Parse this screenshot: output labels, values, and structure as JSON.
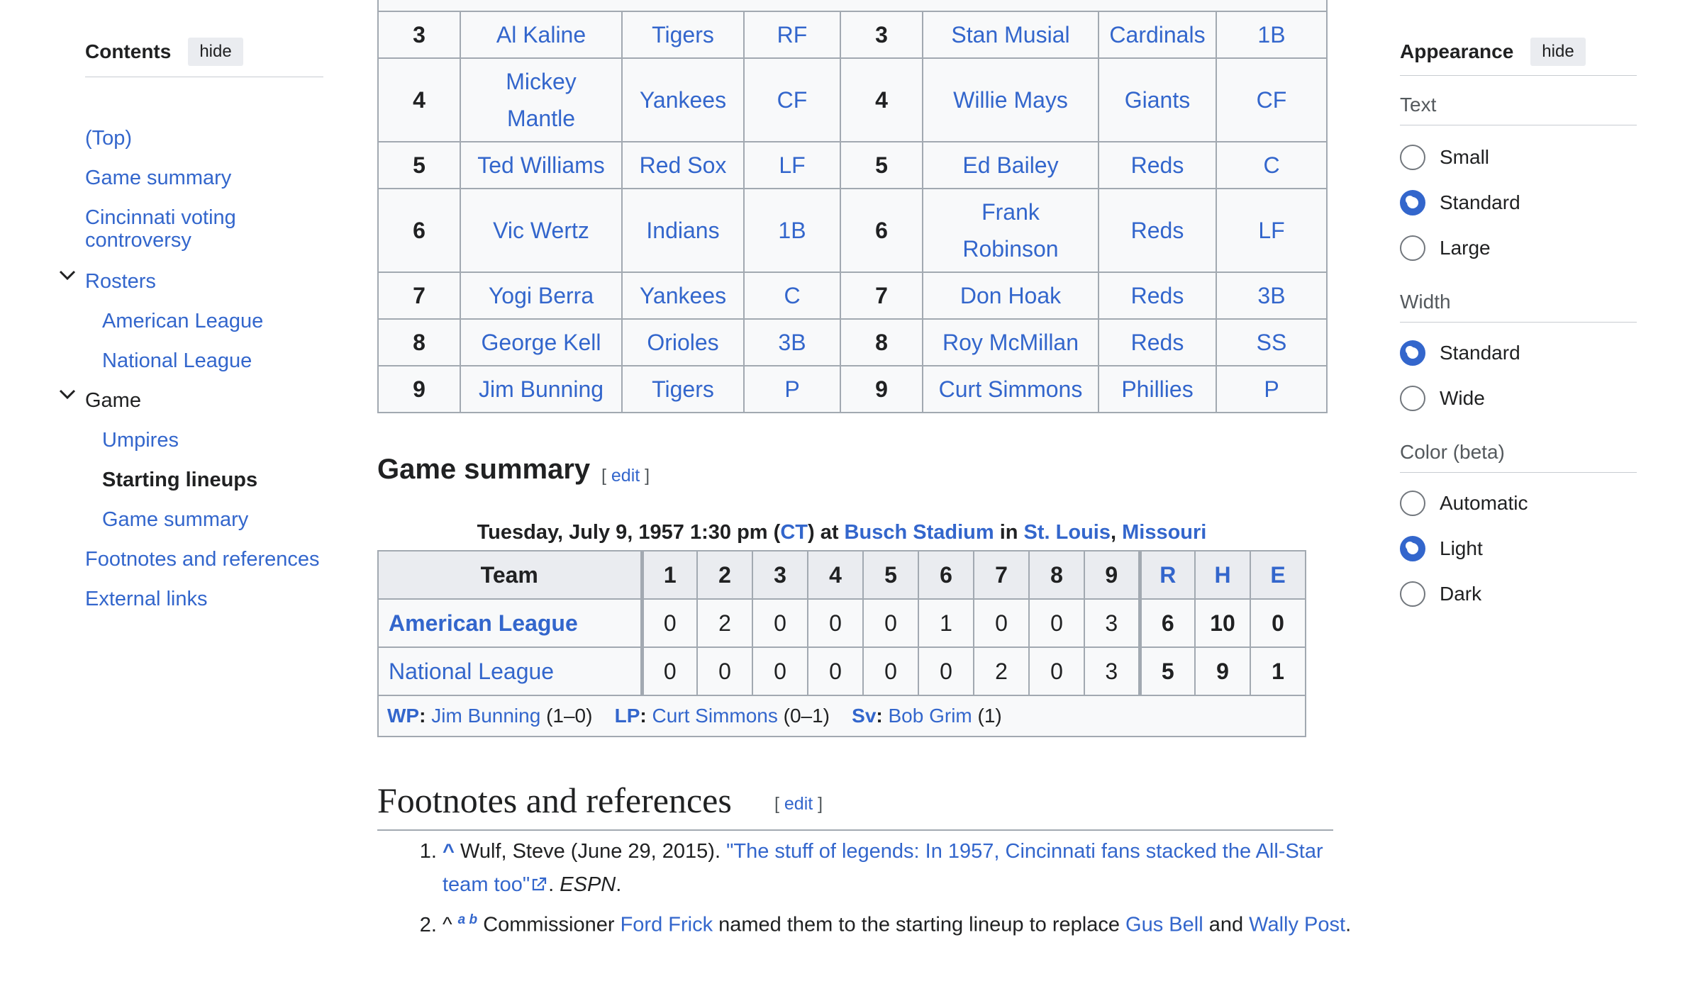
{
  "toc": {
    "title": "Contents",
    "hide_label": "hide",
    "items": {
      "top": "(Top)",
      "game_summary": "Game summary",
      "cincinnati": "Cincinnati voting controversy",
      "rosters": "Rosters",
      "american_league": "American League",
      "national_league": "National League",
      "game": "Game",
      "umpires": "Umpires",
      "starting_lineups": "Starting lineups",
      "game_summary_sub": "Game summary",
      "footnotes": "Footnotes and references",
      "external_links": "External links"
    }
  },
  "appearance": {
    "title": "Appearance",
    "hide_label": "hide",
    "text_label": "Text",
    "text_options": [
      "Small",
      "Standard",
      "Large"
    ],
    "text_selected": "Standard",
    "width_label": "Width",
    "width_options": [
      "Standard",
      "Wide"
    ],
    "width_selected": "Standard",
    "color_label": "Color (beta)",
    "color_options": [
      "Automatic",
      "Light",
      "Dark"
    ],
    "color_selected": "Light"
  },
  "lineup": {
    "rows": [
      {
        "order": "3",
        "al_player": "Al Kaline",
        "al_team": "Tigers",
        "al_pos": "RF",
        "nl_order": "3",
        "nl_player": "Stan Musial",
        "nl_team": "Cardinals",
        "nl_pos": "1B"
      },
      {
        "order": "4",
        "al_player": "Mickey Mantle",
        "al_team": "Yankees",
        "al_pos": "CF",
        "nl_order": "4",
        "nl_player": "Willie Mays",
        "nl_team": "Giants",
        "nl_pos": "CF"
      },
      {
        "order": "5",
        "al_player": "Ted Williams",
        "al_team": "Red Sox",
        "al_pos": "LF",
        "nl_order": "5",
        "nl_player": "Ed Bailey",
        "nl_team": "Reds",
        "nl_pos": "C"
      },
      {
        "order": "6",
        "al_player": "Vic Wertz",
        "al_team": "Indians",
        "al_pos": "1B",
        "nl_order": "6",
        "nl_player": "Frank Robinson",
        "nl_team": "Reds",
        "nl_pos": "LF"
      },
      {
        "order": "7",
        "al_player": "Yogi Berra",
        "al_team": "Yankees",
        "al_pos": "C",
        "nl_order": "7",
        "nl_player": "Don Hoak",
        "nl_team": "Reds",
        "nl_pos": "3B"
      },
      {
        "order": "8",
        "al_player": "George Kell",
        "al_team": "Orioles",
        "al_pos": "3B",
        "nl_order": "8",
        "nl_player": "Roy McMillan",
        "nl_team": "Reds",
        "nl_pos": "SS"
      },
      {
        "order": "9",
        "al_player": "Jim Bunning",
        "al_team": "Tigers",
        "al_pos": "P",
        "nl_order": "9",
        "nl_player": "Curt Simmons",
        "nl_team": "Phillies",
        "nl_pos": "P"
      }
    ]
  },
  "game_summary": {
    "heading": "Game summary",
    "edit": "edit",
    "date_prefix": "Tuesday, July 9, 1957 1:30 pm (",
    "timezone": "CT",
    "date_mid": ") at ",
    "stadium": "Busch Stadium",
    "in_text": " in ",
    "city": "St. Louis",
    "comma": ", ",
    "state": "Missouri",
    "headers": [
      "Team",
      "1",
      "2",
      "3",
      "4",
      "5",
      "6",
      "7",
      "8",
      "9",
      "R",
      "H",
      "E"
    ],
    "teams": [
      {
        "name": "American League",
        "innings": [
          "0",
          "2",
          "0",
          "0",
          "0",
          "1",
          "0",
          "0",
          "3"
        ],
        "r": "6",
        "h": "10",
        "e": "0"
      },
      {
        "name": "National League",
        "innings": [
          "0",
          "0",
          "0",
          "0",
          "0",
          "0",
          "2",
          "0",
          "3"
        ],
        "r": "5",
        "h": "9",
        "e": "1"
      }
    ],
    "wp_label": "WP",
    "wp_name": "Jim Bunning",
    "wp_record": " (1–0)",
    "lp_label": "LP",
    "lp_name": "Curt Simmons",
    "lp_record": " (0–1)",
    "sv_label": "Sv",
    "sv_name": "Bob Grim",
    "sv_record": " (1)"
  },
  "footnotes": {
    "heading": "Footnotes and references",
    "edit": "edit",
    "ref1_caret": "^",
    "ref1_author": " Wulf, Steve (June 29, 2015). ",
    "ref1_title": "\"The stuff of legends: In 1957, Cincinnati fans stacked the All-Star team too\"",
    "ref1_pub": "ESPN",
    "ref2_caret": "^",
    "ref2_a": "a",
    "ref2_b": "b",
    "ref2_t1": " Commissioner ",
    "ref2_link1": "Ford Frick",
    "ref2_t2": " named them to the starting lineup to replace ",
    "ref2_link2": "Gus Bell",
    "ref2_t3": " and ",
    "ref2_link3": "Wally Post"
  },
  "colors": {
    "link": "#3366cc",
    "border": "#a2a9b1",
    "header_bg": "#eaecf0",
    "cell_bg": "#f8f9fa"
  }
}
